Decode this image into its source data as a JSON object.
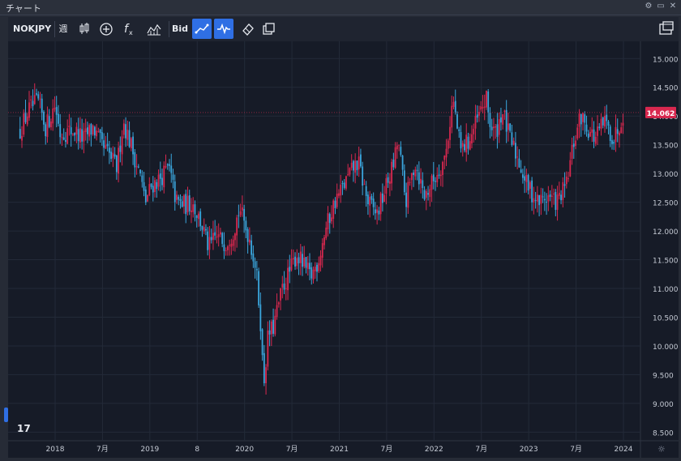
{
  "window": {
    "title": "チャート"
  },
  "toolbar": {
    "symbol": "NOKJPY",
    "interval": "週",
    "bid_label": "Bid"
  },
  "chart_data": {
    "type": "candlestick",
    "symbol": "NOKJPY",
    "interval": "週",
    "last_price": "14.062",
    "ylim": [
      8.35,
      15.3
    ],
    "y_ticks": [
      "15.000",
      "14.500",
      "14.000",
      "13.500",
      "13.000",
      "12.500",
      "12.000",
      "11.500",
      "11.000",
      "10.500",
      "10.000",
      "9.500",
      "9.000",
      "8.500"
    ],
    "x_ticks": [
      {
        "label": "2018",
        "t": 2018.0
      },
      {
        "label": "7月",
        "t": 2018.5
      },
      {
        "label": "2019",
        "t": 2019.0
      },
      {
        "label": "8",
        "t": 2019.5
      },
      {
        "label": "2020",
        "t": 2020.0
      },
      {
        "label": "7月",
        "t": 2020.5
      },
      {
        "label": "2021",
        "t": 2021.0
      },
      {
        "label": "7月",
        "t": 2021.5
      },
      {
        "label": "2022",
        "t": 2022.0
      },
      {
        "label": "7月",
        "t": 2022.5
      },
      {
        "label": "2023",
        "t": 2023.0
      },
      {
        "label": "7月",
        "t": 2023.5
      },
      {
        "label": "2024",
        "t": 2024.0
      }
    ],
    "path": [
      [
        2017.63,
        13.75
      ],
      [
        2017.72,
        14.1
      ],
      [
        2017.82,
        14.25
      ],
      [
        2017.9,
        13.8
      ],
      [
        2018.0,
        14.2
      ],
      [
        2018.05,
        13.7
      ],
      [
        2018.2,
        13.75
      ],
      [
        2018.3,
        13.6
      ],
      [
        2018.4,
        13.8
      ],
      [
        2018.5,
        13.45
      ],
      [
        2018.58,
        13.3
      ],
      [
        2018.65,
        13.1
      ],
      [
        2018.72,
        13.9
      ],
      [
        2018.8,
        13.5
      ],
      [
        2018.9,
        12.95
      ],
      [
        2018.95,
        12.5
      ],
      [
        2019.02,
        12.8
      ],
      [
        2019.1,
        12.9
      ],
      [
        2019.2,
        13.1
      ],
      [
        2019.28,
        12.5
      ],
      [
        2019.38,
        12.45
      ],
      [
        2019.45,
        12.5
      ],
      [
        2019.55,
        12.1
      ],
      [
        2019.62,
        11.7
      ],
      [
        2019.7,
        11.9
      ],
      [
        2019.8,
        11.8
      ],
      [
        2019.88,
        12.0
      ],
      [
        2019.95,
        12.4
      ],
      [
        2020.0,
        12.1
      ],
      [
        2020.05,
        11.9
      ],
      [
        2020.12,
        11.35
      ],
      [
        2020.17,
        10.4
      ],
      [
        2020.2,
        9.3
      ],
      [
        2020.25,
        10.2
      ],
      [
        2020.3,
        10.3
      ],
      [
        2020.4,
        11.0
      ],
      [
        2020.48,
        11.3
      ],
      [
        2020.55,
        11.6
      ],
      [
        2020.62,
        11.4
      ],
      [
        2020.7,
        11.2
      ],
      [
        2020.78,
        11.5
      ],
      [
        2020.85,
        12.0
      ],
      [
        2020.95,
        12.5
      ],
      [
        2021.05,
        12.8
      ],
      [
        2021.15,
        13.1
      ],
      [
        2021.2,
        13.2
      ],
      [
        2021.3,
        12.5
      ],
      [
        2021.4,
        12.3
      ],
      [
        2021.5,
        12.8
      ],
      [
        2021.58,
        13.2
      ],
      [
        2021.62,
        13.6
      ],
      [
        2021.7,
        12.5
      ],
      [
        2021.8,
        13.2
      ],
      [
        2021.9,
        12.6
      ],
      [
        2022.0,
        12.9
      ],
      [
        2022.12,
        13.3
      ],
      [
        2022.2,
        14.3
      ],
      [
        2022.28,
        13.4
      ],
      [
        2022.38,
        13.6
      ],
      [
        2022.45,
        13.9
      ],
      [
        2022.55,
        14.3
      ],
      [
        2022.6,
        13.8
      ],
      [
        2022.65,
        13.7
      ],
      [
        2022.72,
        14.1
      ],
      [
        2022.8,
        13.6
      ],
      [
        2022.9,
        13.2
      ],
      [
        2022.98,
        12.8
      ],
      [
        2023.1,
        12.5
      ],
      [
        2023.2,
        12.6
      ],
      [
        2023.3,
        12.5
      ],
      [
        2023.4,
        12.8
      ],
      [
        2023.47,
        13.5
      ],
      [
        2023.55,
        14.0
      ],
      [
        2023.62,
        13.8
      ],
      [
        2023.7,
        13.6
      ],
      [
        2023.8,
        13.9
      ],
      [
        2023.9,
        13.6
      ],
      [
        2024.0,
        14.062
      ]
    ]
  }
}
